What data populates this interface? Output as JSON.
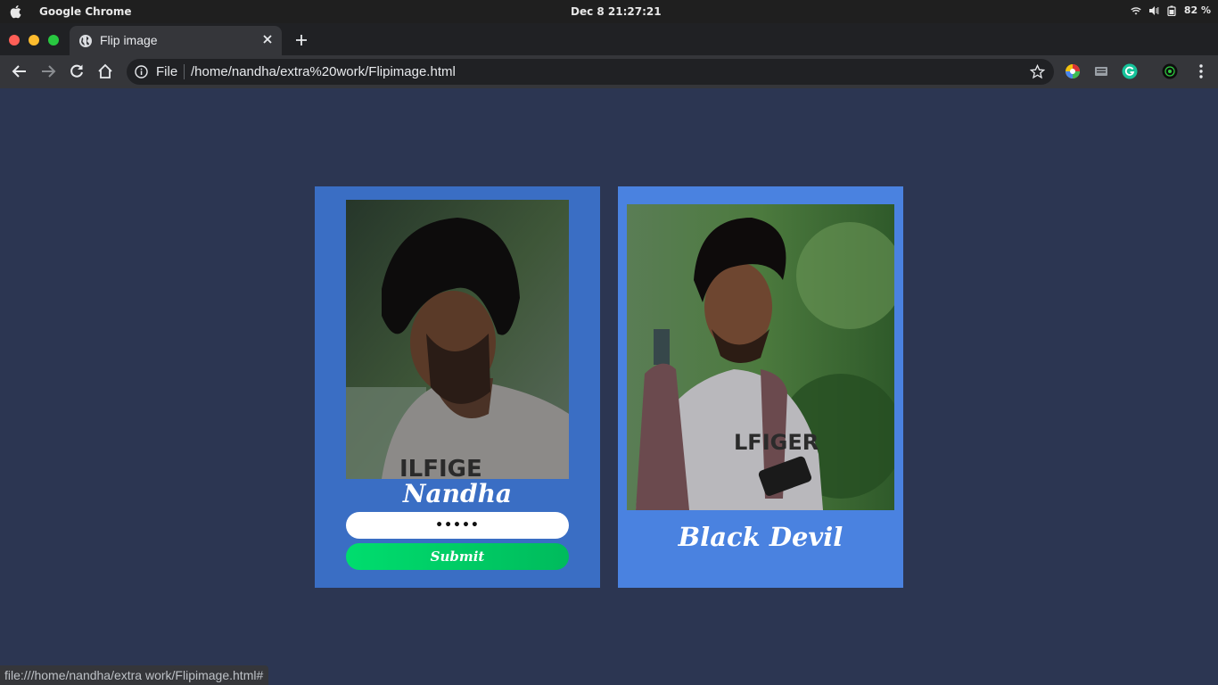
{
  "os": {
    "app_name": "Google Chrome",
    "clock": "Dec 8  21:27:21",
    "battery": "82 %"
  },
  "browser": {
    "tab_title": "Flip image",
    "scheme_label": "File",
    "url": "/home/nandha/extra%20work/Flipimage.html",
    "status_url": "file:///home/nandha/extra work/Flipimage.html#"
  },
  "page": {
    "front_card": {
      "name": "Nandha",
      "password_value": "•••••",
      "submit_label": "Submit"
    },
    "back_card": {
      "name": "Black Devil"
    }
  },
  "colors": {
    "page_background": "#2c3652",
    "front_card": "#3a6ec4",
    "back_card": "#4a82e0",
    "submit_button": "#00cc66"
  }
}
